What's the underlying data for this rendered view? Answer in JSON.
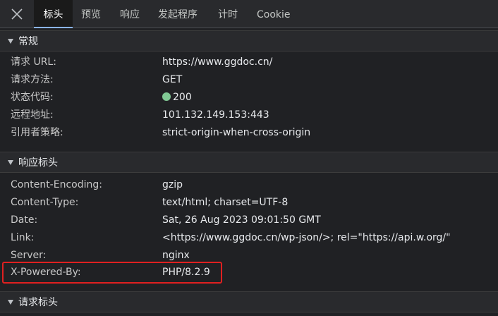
{
  "tabs": [
    {
      "label": "标头"
    },
    {
      "label": "预览"
    },
    {
      "label": "响应"
    },
    {
      "label": "发起程序"
    },
    {
      "label": "计时"
    },
    {
      "label": "Cookie"
    }
  ],
  "general": {
    "title": "常规",
    "rows": [
      {
        "key": "请求 URL:",
        "value": "https://www.ggdoc.cn/"
      },
      {
        "key": "请求方法:",
        "value": "GET"
      },
      {
        "key": "状态代码:",
        "value": "200"
      },
      {
        "key": "远程地址:",
        "value": "101.132.149.153:443"
      },
      {
        "key": "引用者策略:",
        "value": "strict-origin-when-cross-origin"
      }
    ]
  },
  "response_headers": {
    "title": "响应标头",
    "rows": [
      {
        "key": "Content-Encoding:",
        "value": "gzip"
      },
      {
        "key": "Content-Type:",
        "value": "text/html; charset=UTF-8"
      },
      {
        "key": "Date:",
        "value": "Sat, 26 Aug 2023 09:01:50 GMT"
      },
      {
        "key": "Link:",
        "value": "<https://www.ggdoc.cn/wp-json/>; rel=\"https://api.w.org/\""
      },
      {
        "key": "Server:",
        "value": "nginx"
      },
      {
        "key": "X-Powered-By:",
        "value": "PHP/8.2.9"
      }
    ]
  },
  "request_headers": {
    "title": "请求标头"
  },
  "colors": {
    "status_ok": "#81c995",
    "highlight": "#e02020",
    "active_tab_underline": "#8ab4f8"
  }
}
